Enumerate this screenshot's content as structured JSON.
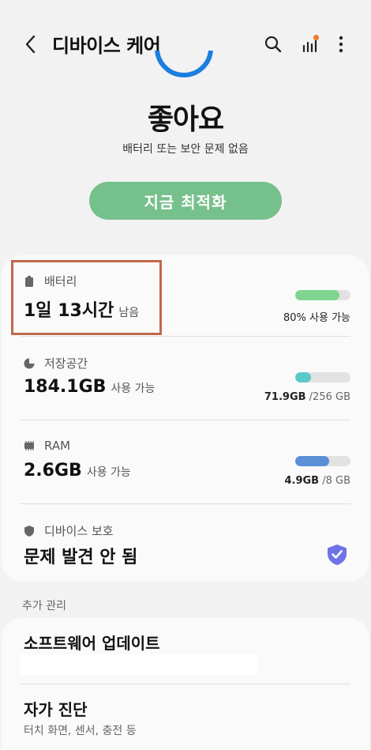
{
  "header": {
    "title": "디바이스 케어"
  },
  "status": {
    "title": "좋아요",
    "subtitle": "배터리 또는 보안 문제 없음",
    "ring_color": "#1a7fe0"
  },
  "optimize_button": {
    "label": "지금 최적화",
    "color": "#76c08b"
  },
  "battery": {
    "label": "배터리",
    "value": "1일 13시간",
    "suffix": "남음",
    "fill_percent": 80,
    "fill_color": "#7fd48f",
    "note": "80% 사용 가능"
  },
  "storage": {
    "label": "저장공간",
    "value": "184.1GB",
    "suffix": "사용 가능",
    "fill_percent": 28,
    "fill_color": "#5cc8c8",
    "used": "71.9GB",
    "total": "/256 GB"
  },
  "ram": {
    "label": "RAM",
    "value": "2.6GB",
    "suffix": "사용 가능",
    "fill_percent": 61,
    "fill_color": "#5b8fd6",
    "used": "4.9GB",
    "total": "/8 GB"
  },
  "protection": {
    "label": "디바이스 보호",
    "value": "문제 발견 안 됨",
    "badge_color": "#6f73e8"
  },
  "additional": {
    "section_label": "추가 관리",
    "items": [
      {
        "title": "소프트웨어 업데이트",
        "subtitle": ""
      },
      {
        "title": "자가 진단",
        "subtitle": "터치 화면, 센서, 충전 등"
      }
    ]
  },
  "highlight_color": "#c0694a"
}
